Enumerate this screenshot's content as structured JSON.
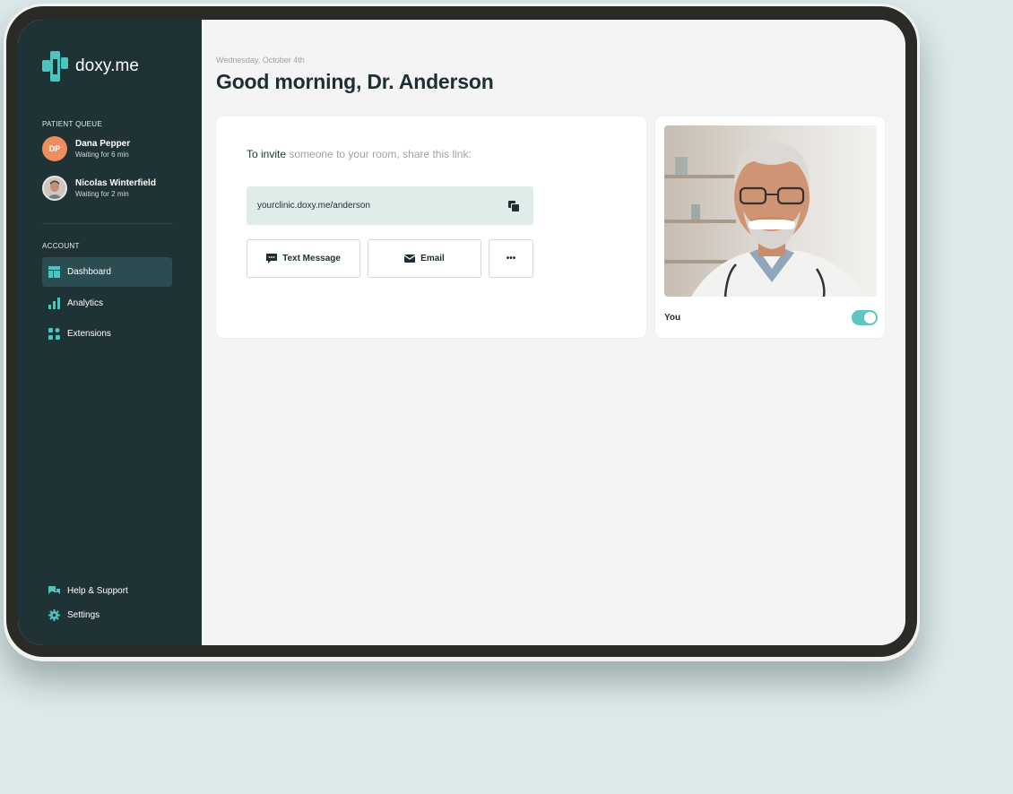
{
  "brand": {
    "name": "doxy.me",
    "accent": "#4fc3bd"
  },
  "sidebar": {
    "patient_queue_label": "PATIENT QUEUE",
    "queue": [
      {
        "initials": "DP",
        "name": "Dana Pepper",
        "wait": "Waiting for 6 min"
      },
      {
        "initials": "",
        "name": "Nicolas Winterfield",
        "wait": "Waiting for 2 min"
      }
    ],
    "account_label": "ACCOUNT",
    "nav": [
      {
        "label": "Dashboard",
        "icon": "dashboard-icon",
        "active": true
      },
      {
        "label": "Analytics",
        "icon": "analytics-icon"
      },
      {
        "label": "Extensions",
        "icon": "extensions-icon"
      }
    ],
    "footer": [
      {
        "label": "Help & Support",
        "icon": "chat-bubbles-icon"
      },
      {
        "label": "Settings",
        "icon": "gear-icon"
      }
    ]
  },
  "main": {
    "date": "Wednesday, October 4th",
    "greeting": "Good morning, Dr. Anderson",
    "invite": {
      "prefix": "To invite",
      "suffix": " someone to your room, share this link:",
      "link": "yourclinic.doxy.me/anderson",
      "buttons": {
        "text_message": "Text Message",
        "email": "Email",
        "more": "•••"
      }
    },
    "self_view": {
      "label": "You",
      "toggle_on": true
    }
  }
}
